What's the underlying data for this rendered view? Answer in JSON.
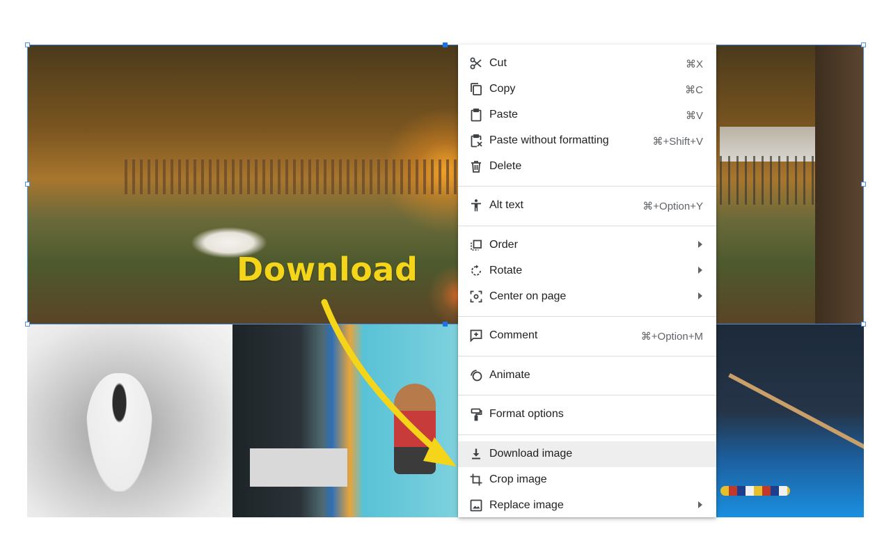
{
  "annotation": {
    "text": "Download",
    "color": "#f4d51a"
  },
  "selection": {
    "color": "#4a90e2"
  },
  "context_menu": {
    "highlight_color": "#eeeeee",
    "items": [
      {
        "label": "Cut",
        "shortcut": "⌘X",
        "icon": "scissors-icon"
      },
      {
        "label": "Copy",
        "shortcut": "⌘C",
        "icon": "copy-icon"
      },
      {
        "label": "Paste",
        "shortcut": "⌘V",
        "icon": "clipboard-icon"
      },
      {
        "label": "Paste without formatting",
        "shortcut": "⌘+Shift+V",
        "icon": "clipboard-plain-icon"
      },
      {
        "label": "Delete",
        "shortcut": "",
        "icon": "trash-icon"
      },
      {
        "label": "Alt text",
        "shortcut": "⌘+Option+Y",
        "icon": "accessibility-icon"
      },
      {
        "label": "Order",
        "shortcut": "",
        "icon": "order-icon",
        "submenu": true
      },
      {
        "label": "Rotate",
        "shortcut": "",
        "icon": "rotate-icon",
        "submenu": true
      },
      {
        "label": "Center on page",
        "shortcut": "",
        "icon": "center-icon",
        "submenu": true
      },
      {
        "label": "Comment",
        "shortcut": "⌘+Option+M",
        "icon": "comment-icon"
      },
      {
        "label": "Animate",
        "shortcut": "",
        "icon": "animate-icon"
      },
      {
        "label": "Format options",
        "shortcut": "",
        "icon": "paint-roller-icon"
      },
      {
        "label": "Download image",
        "shortcut": "",
        "icon": "download-icon",
        "highlighted": true
      },
      {
        "label": "Crop image",
        "shortcut": "",
        "icon": "crop-icon"
      },
      {
        "label": "Replace image",
        "shortcut": "",
        "icon": "image-icon",
        "submenu": true
      }
    ]
  }
}
